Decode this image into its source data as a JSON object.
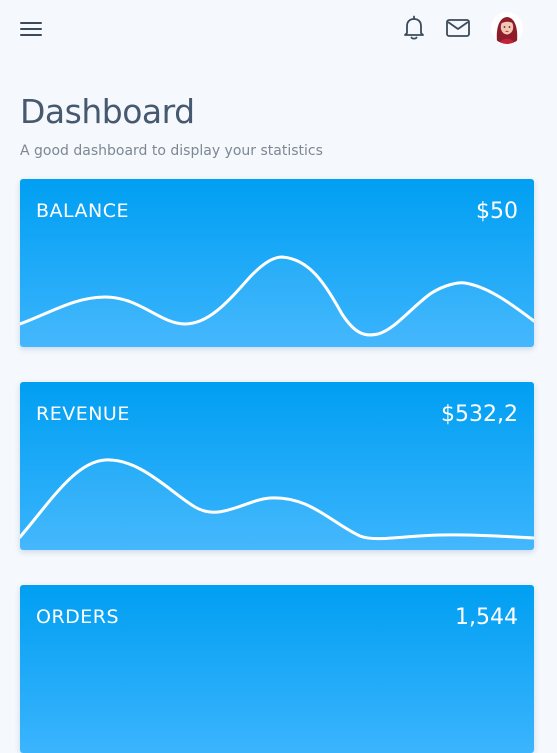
{
  "header": {
    "menu_icon": "hamburger-menu-icon",
    "notifications_icon": "bell-icon",
    "messages_icon": "mail-icon",
    "avatar_icon": "user-avatar"
  },
  "page": {
    "title": "Dashboard",
    "subtitle": "A good dashboard to display your statistics"
  },
  "cards": [
    {
      "label": "BALANCE",
      "value": "$50"
    },
    {
      "label": "REVENUE",
      "value": "$532,2"
    },
    {
      "label": "ORDERS",
      "value": "1,544"
    }
  ],
  "colors": {
    "card_gradient_top": "#009ff2",
    "card_gradient_bottom": "#3bb4fd",
    "title": "#46596f",
    "subtitle": "#7d8894",
    "background": "#f5f8fc"
  }
}
